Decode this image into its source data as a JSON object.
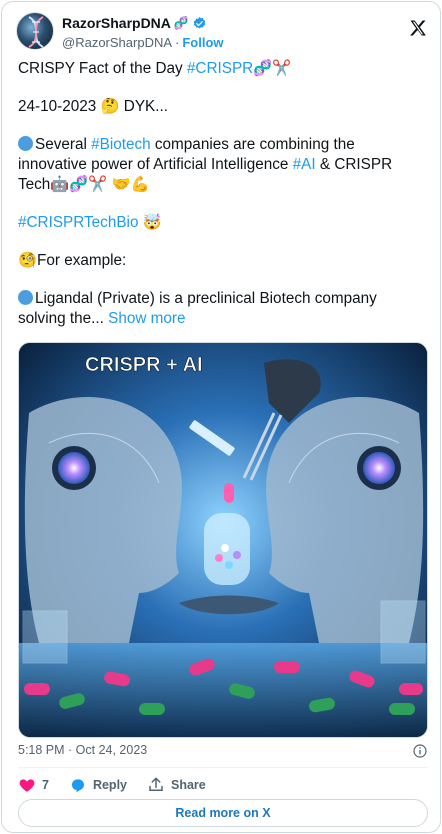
{
  "author": {
    "display_name": "RazorSharpDNA",
    "name_emoji": "🧬",
    "handle": "@RazorSharpDNA",
    "separator": "·",
    "follow_label": "Follow"
  },
  "tweet": {
    "lines": [
      [
        "CRISPY Fact of the Day ",
        "#CRISPR",
        "🧬✂️"
      ],
      [
        "24-10-2023 🤔 DYK..."
      ],
      [
        "Several ",
        "#Biotech",
        " companies are combining the"
      ],
      [
        "innovative power of Artificial Intelligence ",
        "#AI",
        " & CRISPR"
      ],
      [
        "Tech🤖🧬✂️ 🤝💪"
      ],
      [
        "#CRISPRTechBio",
        " 🤯"
      ],
      [
        "🧐For example:"
      ],
      [
        "Ligandal (Private) is a preclinical Biotech company"
      ],
      [
        "solving the... ",
        "Show more"
      ]
    ]
  },
  "media": {
    "overlay_title": "CRISPR + AI",
    "alt": ""
  },
  "timestamp": "5:18 PM · Oct 24, 2023",
  "actions": {
    "like_count": "7",
    "reply_label": "Reply",
    "share_label": "Share"
  },
  "read_more_label": "Read more on X",
  "colors": {
    "link": "#1d9bf0",
    "like": "#f91880",
    "text": "#0f1419",
    "muted": "#536471",
    "border": "#cfd9de"
  },
  "icons": [
    "verified-badge-icon",
    "x-logo-icon",
    "info-icon",
    "heart-icon",
    "reply-icon",
    "share-icon"
  ]
}
